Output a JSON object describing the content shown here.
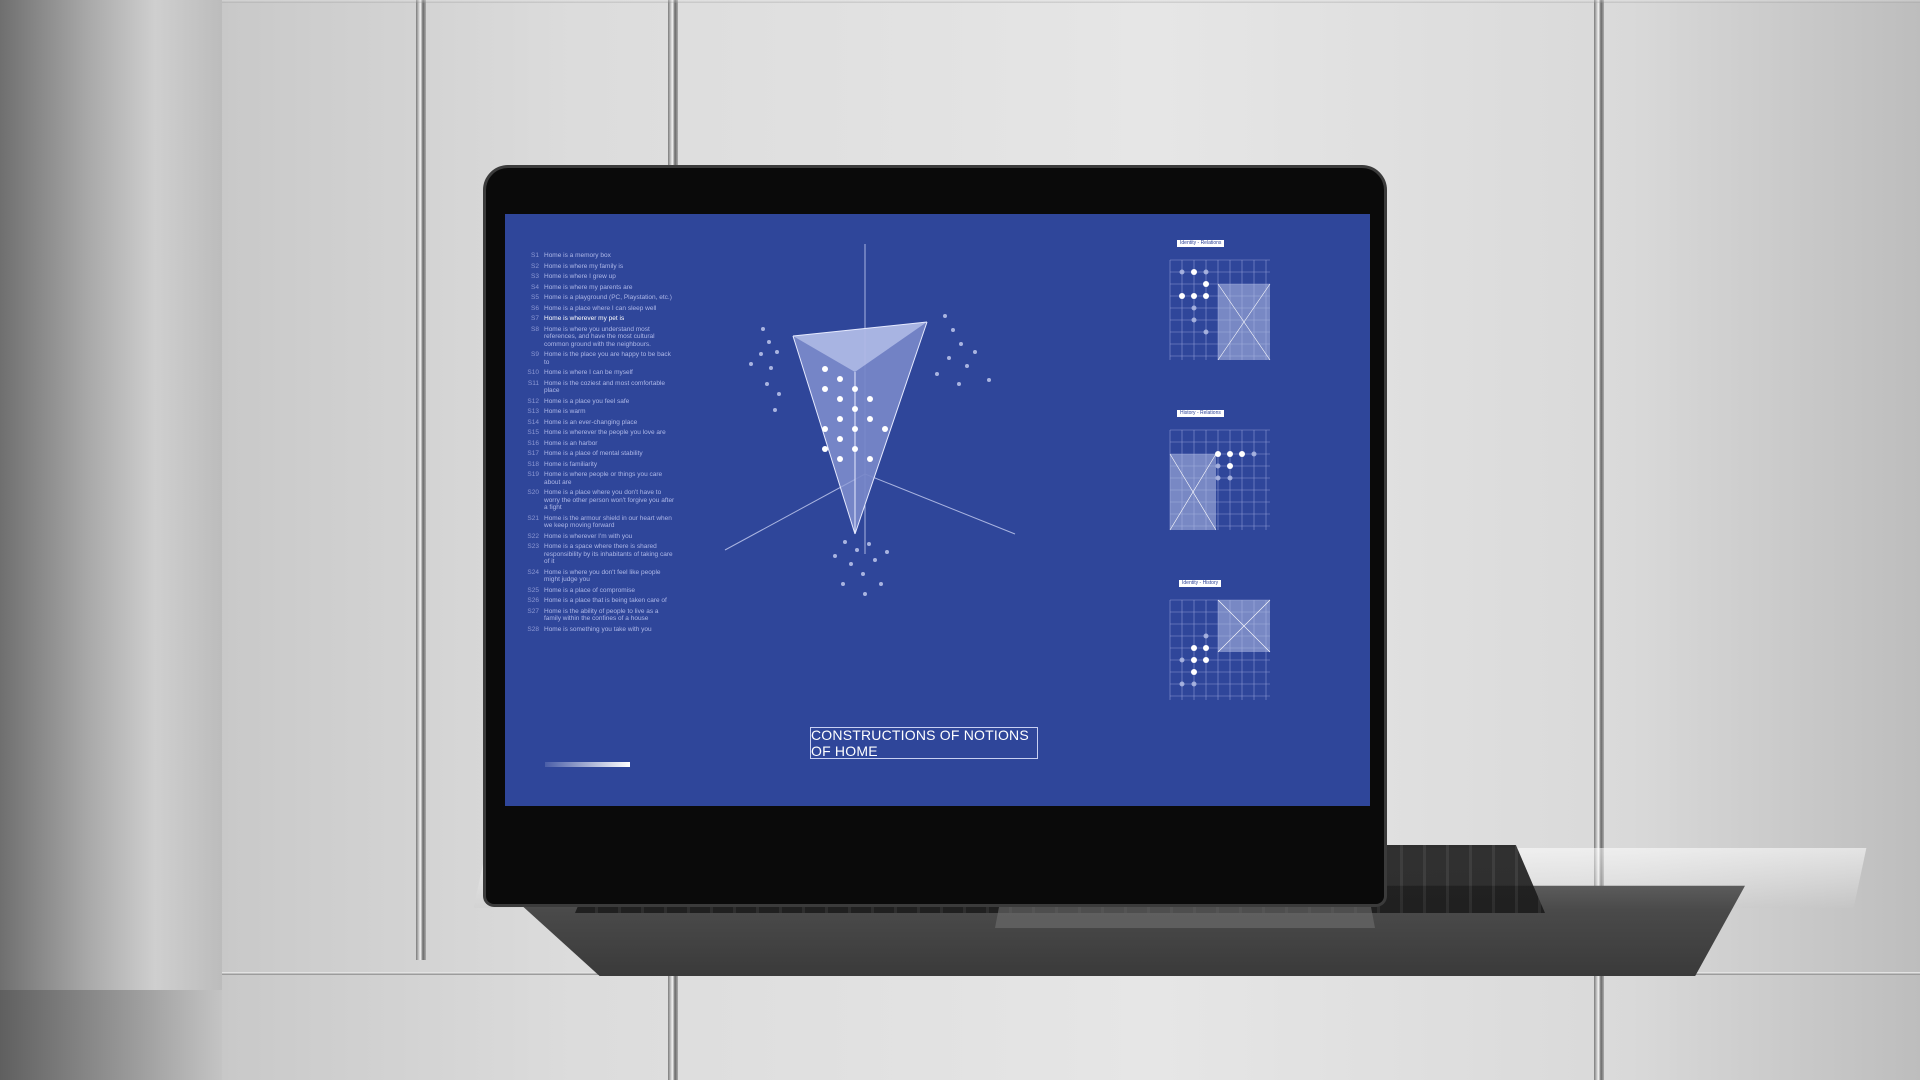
{
  "page": {
    "title": "CONSTRUCTIONS OF NOTIONS OF HOME"
  },
  "statements": [
    {
      "num": "S1",
      "text": "Home is a memory box"
    },
    {
      "num": "S2",
      "text": "Home is where my family is"
    },
    {
      "num": "S3",
      "text": "Home is where I grew up"
    },
    {
      "num": "S4",
      "text": "Home is where my parents are"
    },
    {
      "num": "S5",
      "text": "Home is a playground (PC, Playstation, etc.)"
    },
    {
      "num": "S6",
      "text": "Home is a place where I can sleep well"
    },
    {
      "num": "S7",
      "text": "Home is wherever my pet is"
    },
    {
      "num": "S8",
      "text": "Home is where you understand most references, and have the most cultural common ground with the neighbours."
    },
    {
      "num": "S9",
      "text": "Home is the place you are happy to be back to"
    },
    {
      "num": "S10",
      "text": "Home is where I can be myself"
    },
    {
      "num": "S11",
      "text": "Home is the coziest and most comfortable place"
    },
    {
      "num": "S12",
      "text": "Home is a place you feel safe"
    },
    {
      "num": "S13",
      "text": "Home is warm"
    },
    {
      "num": "S14",
      "text": "Home is an ever-changing place"
    },
    {
      "num": "S15",
      "text": "Home is wherever the people you love are"
    },
    {
      "num": "S16",
      "text": "Home is an harbor"
    },
    {
      "num": "S17",
      "text": "Home is a place of mental stability"
    },
    {
      "num": "S18",
      "text": "Home is familiarity"
    },
    {
      "num": "S19",
      "text": "Home is where people or things you care about are"
    },
    {
      "num": "S20",
      "text": "Home is a place where you don't have to worry the other person won't forgive you after a fight"
    },
    {
      "num": "S21",
      "text": "Home is the armour shield in our heart when we keep moving forward"
    },
    {
      "num": "S22",
      "text": "Home is wherever I'm with you"
    },
    {
      "num": "S23",
      "text": "Home is a space where there is shared responsibility by its inhabitants of taking care of it"
    },
    {
      "num": "S24",
      "text": "Home is where you don't feel like people might judge you"
    },
    {
      "num": "S25",
      "text": "Home is a place of compromise"
    },
    {
      "num": "S26",
      "text": "Home is a place that is being taken care of"
    },
    {
      "num": "S27",
      "text": "Home is the ability of people to live as a family within the confines of a house"
    },
    {
      "num": "S28",
      "text": "Home is something you take with you"
    }
  ],
  "highlighted_statement": "S7",
  "panels": [
    {
      "title": "Identity - Relations"
    },
    {
      "title": "History - Relations"
    },
    {
      "title": "Identity - History"
    }
  ],
  "colors": {
    "screen_bg": "#2f469a",
    "accent": "#ffffff",
    "muted_text": "#aeb8e8"
  }
}
